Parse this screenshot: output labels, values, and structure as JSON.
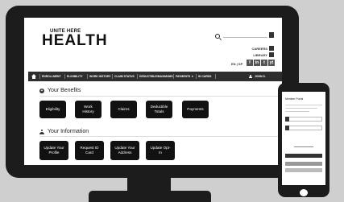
{
  "brand": {
    "line1": "UNITE HERE",
    "line2": "HEALTH"
  },
  "header": {
    "careers": "CAREERS",
    "library": "LIBRARY",
    "lang": "EN | SP",
    "social": [
      "f",
      "in",
      "t",
      "yt"
    ]
  },
  "nav": {
    "items": [
      "ENROLLMENT",
      "ELIGIBILITY",
      "WORK HISTORY",
      "CLAIM STATUS",
      "DEDUCTIBLE/MAXIMUMS",
      "PAYMENTS",
      "ID CARDS"
    ],
    "user": "JOHN D."
  },
  "benefits": {
    "title": "Your Benefits",
    "tiles": [
      "Eligibility",
      "Work\nHistory",
      "Claims",
      "Deductible\nTotals",
      "Payments"
    ]
  },
  "information": {
    "title": "Your Information",
    "tiles": [
      "Update Your\nProfile",
      "Request ID\nCard",
      "Update Your\nAddress",
      "Update Opt-\nIn"
    ]
  },
  "phone": {
    "title": "Member Portal"
  },
  "colors": {
    "frame": "#1c1c1c",
    "tile": "#111111",
    "navbar": "#2e2e2e",
    "background": "#cfcfcf"
  }
}
